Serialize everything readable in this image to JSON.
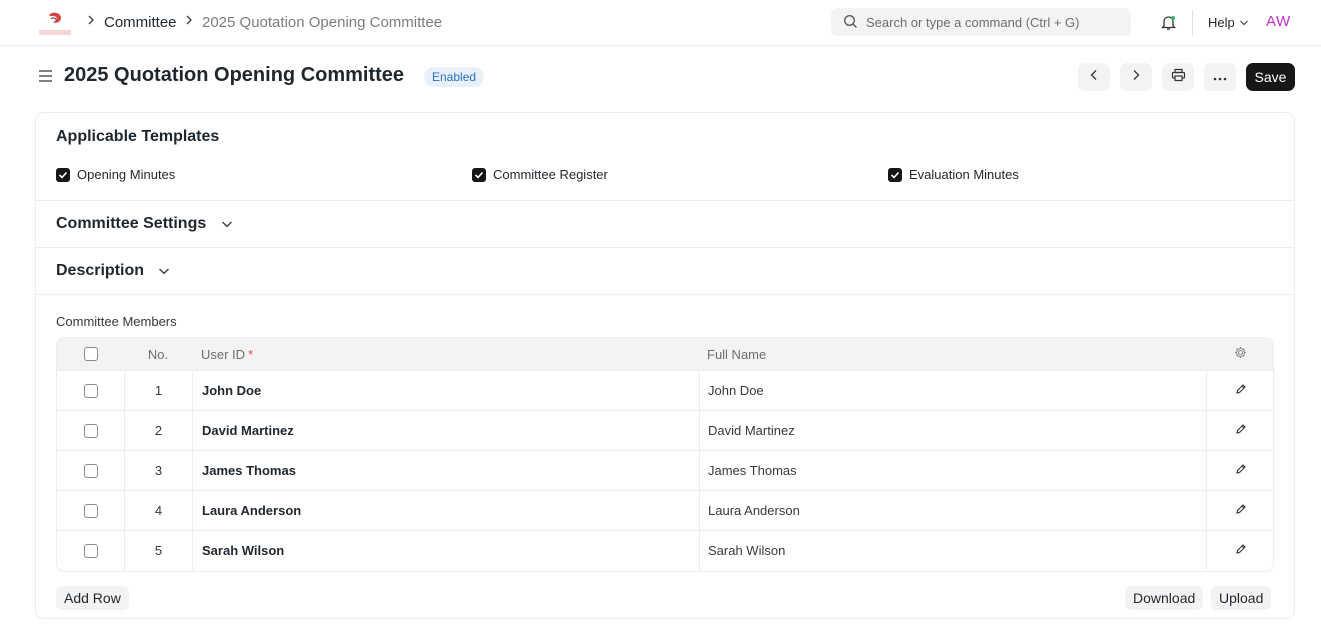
{
  "navbar": {
    "breadcrumbs": [
      "Committee",
      "2025 Quotation Opening Committee"
    ],
    "search_placeholder": "Search or type a command (Ctrl + G)",
    "help_label": "Help",
    "avatar_initials": "AW"
  },
  "page": {
    "title": "2025 Quotation Opening Committee",
    "status": "Enabled",
    "save_label": "Save"
  },
  "sections": {
    "templates_title": "Applicable Templates",
    "templates": [
      {
        "label": "Opening Minutes",
        "checked": true
      },
      {
        "label": "Committee Register",
        "checked": true
      },
      {
        "label": "Evaluation Minutes",
        "checked": true
      }
    ],
    "settings_title": "Committee Settings",
    "description_title": "Description"
  },
  "members": {
    "label": "Committee Members",
    "headers": {
      "no": "No.",
      "user_id": "User ID",
      "required_mark": "*",
      "full_name": "Full Name"
    },
    "rows": [
      {
        "no": "1",
        "user_id": "John Doe",
        "full_name": "John Doe"
      },
      {
        "no": "2",
        "user_id": "David Martinez",
        "full_name": "David Martinez"
      },
      {
        "no": "3",
        "user_id": "James Thomas",
        "full_name": "James Thomas"
      },
      {
        "no": "4",
        "user_id": "Laura Anderson",
        "full_name": "Laura Anderson"
      },
      {
        "no": "5",
        "user_id": "Sarah Wilson",
        "full_name": "Sarah Wilson"
      }
    ],
    "add_row_label": "Add Row",
    "download_label": "Download",
    "upload_label": "Upload"
  }
}
